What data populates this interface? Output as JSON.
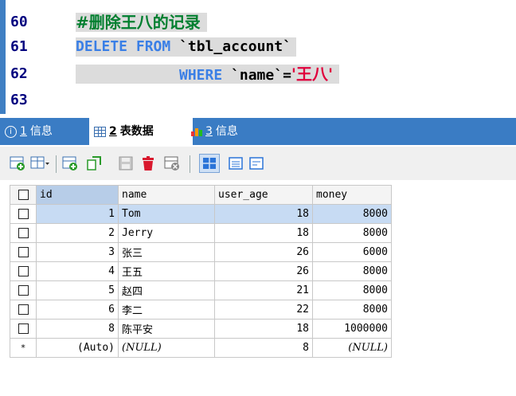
{
  "editor": {
    "lines": [
      {
        "num": "60",
        "comment": "#删除王八的记录"
      },
      {
        "num": "61",
        "keyword1": "DELETE",
        "keyword2": "FROM",
        "table": "`tbl_account`"
      },
      {
        "num": "62",
        "keyword": "WHERE",
        "column": "`name`",
        "operator": "=",
        "value": "'王八'"
      },
      {
        "num": "63"
      }
    ]
  },
  "tabs": [
    {
      "icon": "info-icon",
      "num": "1",
      "label": "信息"
    },
    {
      "icon": "table-icon",
      "num": "2",
      "label": "表数据"
    },
    {
      "icon": "chart-icon",
      "num": "3",
      "label": "信息"
    }
  ],
  "toolbar": {
    "icons": [
      "add-row-icon",
      "insert-options-icon",
      "copy-row-icon",
      "refresh-icon",
      "save-icon",
      "delete-icon",
      "discard-icon",
      "grid-view-icon",
      "form-view-icon",
      "text-view-icon"
    ]
  },
  "grid": {
    "columns": [
      "id",
      "name",
      "user_age",
      "money"
    ],
    "rows": [
      {
        "id": "1",
        "name": "Tom",
        "user_age": "18",
        "money": "8000"
      },
      {
        "id": "2",
        "name": "Jerry",
        "user_age": "18",
        "money": "8000"
      },
      {
        "id": "3",
        "name": "张三",
        "user_age": "26",
        "money": "6000"
      },
      {
        "id": "4",
        "name": "王五",
        "user_age": "26",
        "money": "8000"
      },
      {
        "id": "5",
        "name": "赵四",
        "user_age": "21",
        "money": "8000"
      },
      {
        "id": "6",
        "name": "李二",
        "user_age": "22",
        "money": "8000"
      },
      {
        "id": "8",
        "name": "陈平安",
        "user_age": "18",
        "money": "1000000"
      }
    ],
    "new_row": {
      "marker": "*",
      "id": "(Auto)",
      "name": "(NULL)",
      "user_age": "8",
      "money": "(NULL)"
    }
  },
  "colors": {
    "accent": "#3a7cc4",
    "keyword": "#3a7fe6",
    "comment": "#007f2f",
    "string": "#e0003c",
    "line_number": "#00007f"
  }
}
